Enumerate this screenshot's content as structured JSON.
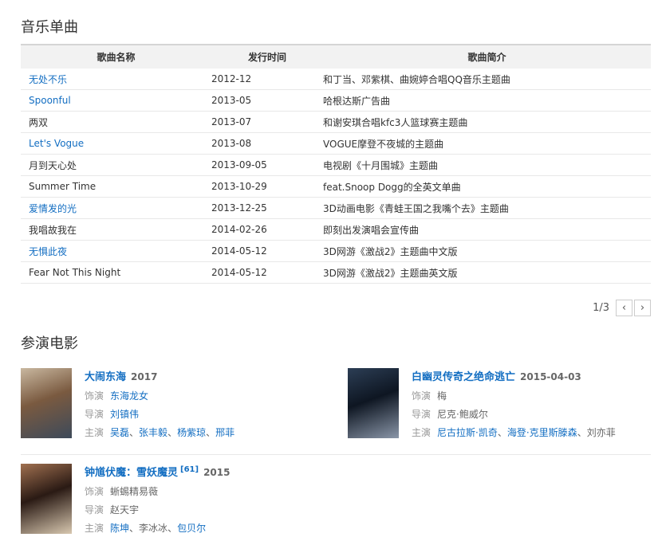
{
  "music": {
    "title": "音乐单曲",
    "headers": [
      "歌曲名称",
      "发行时间",
      "歌曲简介"
    ],
    "rows": [
      {
        "name": "无处不乐",
        "link": true,
        "date": "2012-12",
        "desc": "和丁当、邓紫棋、曲婉婷合唱QQ音乐主题曲"
      },
      {
        "name": "Spoonful",
        "link": true,
        "date": "2013-05",
        "desc": "哈根达斯广告曲"
      },
      {
        "name": "两双",
        "link": false,
        "date": "2013-07",
        "desc": "和谢安琪合唱kfc3人篮球赛主题曲"
      },
      {
        "name": "Let's Vogue",
        "link": true,
        "date": "2013-08",
        "desc": "VOGUE摩登不夜城的主题曲"
      },
      {
        "name": "月到天心处",
        "link": false,
        "date": "2013-09-05",
        "desc": "电视剧《十月围城》主题曲"
      },
      {
        "name": "Summer Time",
        "link": false,
        "date": "2013-10-29",
        "desc": "feat.Snoop Dogg的全英文单曲"
      },
      {
        "name": "爱情发的光",
        "link": true,
        "date": "2013-12-25",
        "desc": "3D动画电影《青蛙王国之我嘴个去》主题曲"
      },
      {
        "name": "我唱故我在",
        "link": false,
        "date": "2014-02-26",
        "desc": "即刻出发演唱会宣传曲"
      },
      {
        "name": "无惧此夜",
        "link": true,
        "date": "2014-05-12",
        "desc": "3D网游《激战2》主题曲中文版"
      },
      {
        "name": "Fear Not This Night",
        "link": false,
        "date": "2014-05-12",
        "desc": "3D网游《激战2》主题曲英文版"
      }
    ],
    "pager": {
      "text": "1/3",
      "prev": "‹",
      "next": "›"
    }
  },
  "movies": {
    "title": "参演电影",
    "labels": {
      "role": "饰演",
      "director": "导演",
      "cast": "主演"
    },
    "items": [
      {
        "title": "大闹东海",
        "year": "2017",
        "note": "",
        "role": "东海龙女",
        "role_link": true,
        "director": "刘镇伟",
        "director_link": true,
        "cast": [
          {
            "name": "吴磊",
            "link": true
          },
          {
            "name": "张丰毅",
            "link": true
          },
          {
            "name": "杨紫琼",
            "link": true
          },
          {
            "name": "邢菲",
            "link": true
          }
        ],
        "poster_colors": [
          "#7a5a40",
          "#c9b8a0",
          "#3d4a5a"
        ]
      },
      {
        "title": "白幽灵传奇之绝命逃亡",
        "year": "2015-04-03",
        "note": "",
        "role": "梅",
        "role_link": false,
        "director": "尼克·鲍威尔",
        "director_link": false,
        "cast": [
          {
            "name": "尼古拉斯·凯奇",
            "link": true
          },
          {
            "name": "海登·克里斯滕森",
            "link": true
          },
          {
            "name": "刘亦菲",
            "link": false
          }
        ],
        "poster_colors": [
          "#0e1622",
          "#2c3e55",
          "#8a96a8"
        ]
      },
      {
        "title": "钟馗伏魔：雪妖魔灵",
        "year": "2015",
        "note": "[61]",
        "role": "蜥蜴精易薇",
        "role_link": false,
        "director": "赵天宇",
        "director_link": false,
        "cast": [
          {
            "name": "陈坤",
            "link": true
          },
          {
            "name": "李冰冰",
            "link": false
          },
          {
            "name": "包贝尔",
            "link": true
          }
        ],
        "poster_colors": [
          "#2a1a14",
          "#a07050",
          "#d8c8b0"
        ]
      }
    ]
  }
}
